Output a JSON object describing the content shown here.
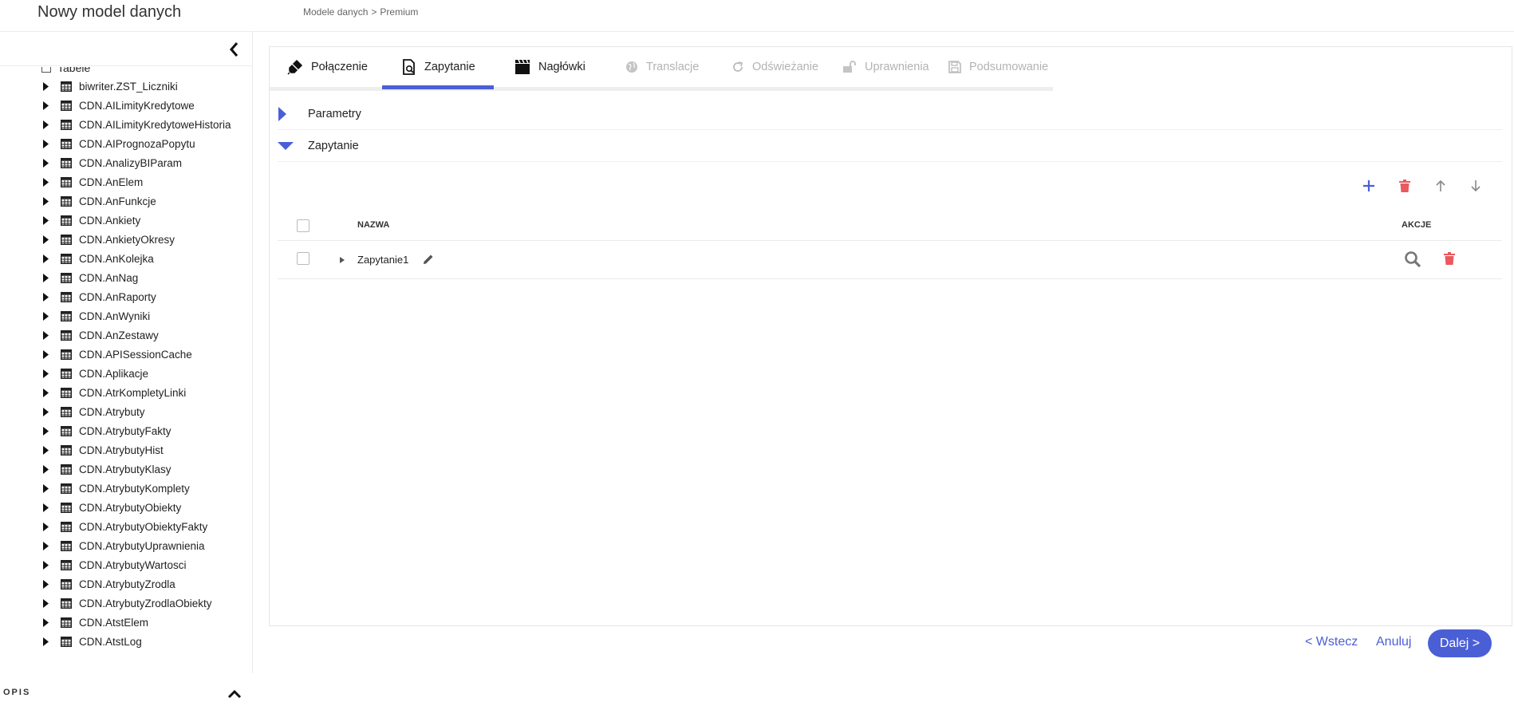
{
  "header": {
    "title": "Nowy model danych",
    "breadcrumb": [
      "Modele danych",
      "Premium"
    ],
    "breadcrumb_sep": ">"
  },
  "sidebar": {
    "root_label": "Tabele",
    "items": [
      {
        "label": "biwriter.ZST_Liczniki"
      },
      {
        "label": "CDN.AILimityKredytowe"
      },
      {
        "label": "CDN.AILimityKredytoweHistoria"
      },
      {
        "label": "CDN.AIPrognozaPopytu"
      },
      {
        "label": "CDN.AnalizyBIParam"
      },
      {
        "label": "CDN.AnElem"
      },
      {
        "label": "CDN.AnFunkcje"
      },
      {
        "label": "CDN.Ankiety"
      },
      {
        "label": "CDN.AnkietyOkresy"
      },
      {
        "label": "CDN.AnKolejka"
      },
      {
        "label": "CDN.AnNag"
      },
      {
        "label": "CDN.AnRaporty"
      },
      {
        "label": "CDN.AnWyniki"
      },
      {
        "label": "CDN.AnZestawy"
      },
      {
        "label": "CDN.APISessionCache"
      },
      {
        "label": "CDN.Aplikacje"
      },
      {
        "label": "CDN.AtrKompletyLinki"
      },
      {
        "label": "CDN.Atrybuty"
      },
      {
        "label": "CDN.AtrybutyFakty"
      },
      {
        "label": "CDN.AtrybutyHist"
      },
      {
        "label": "CDN.AtrybutyKlasy"
      },
      {
        "label": "CDN.AtrybutyKomplety"
      },
      {
        "label": "CDN.AtrybutyObiekty"
      },
      {
        "label": "CDN.AtrybutyObiektyFakty"
      },
      {
        "label": "CDN.AtrybutyUprawnienia"
      },
      {
        "label": "CDN.AtrybutyWartosci"
      },
      {
        "label": "CDN.AtrybutyZrodla"
      },
      {
        "label": "CDN.AtrybutyZrodlaObiekty"
      },
      {
        "label": "CDN.AtstElem"
      },
      {
        "label": "CDN.AtstLog"
      }
    ],
    "bottom_label": "OPIS"
  },
  "tabs": [
    {
      "label": "Połączenie",
      "icon": "plug-icon",
      "disabled": false
    },
    {
      "label": "Zapytanie",
      "icon": "query-icon",
      "disabled": false,
      "active": true
    },
    {
      "label": "Nagłówki",
      "icon": "clapperboard-icon",
      "disabled": false
    },
    {
      "label": "Translacje",
      "icon": "globe-icon",
      "disabled": true
    },
    {
      "label": "Odświeżanie",
      "icon": "refresh-icon",
      "disabled": true
    },
    {
      "label": "Uprawnienia",
      "icon": "unlock-icon",
      "disabled": true
    },
    {
      "label": "Podsumowanie",
      "icon": "save-icon",
      "disabled": true
    }
  ],
  "sections": {
    "params": {
      "label": "Parametry",
      "expanded": false
    },
    "query": {
      "label": "Zapytanie",
      "expanded": true
    }
  },
  "grid": {
    "columns": {
      "name": "NAZWA",
      "actions": "AKCJE"
    },
    "rows": [
      {
        "name": "Zapytanie1"
      }
    ]
  },
  "footer": {
    "back": "< Wstecz",
    "cancel": "Anuluj",
    "next": "Dalej >"
  },
  "colors": {
    "accent": "#4a5fd6",
    "danger": "#e9595d",
    "disabled": "#b3b3b3"
  }
}
